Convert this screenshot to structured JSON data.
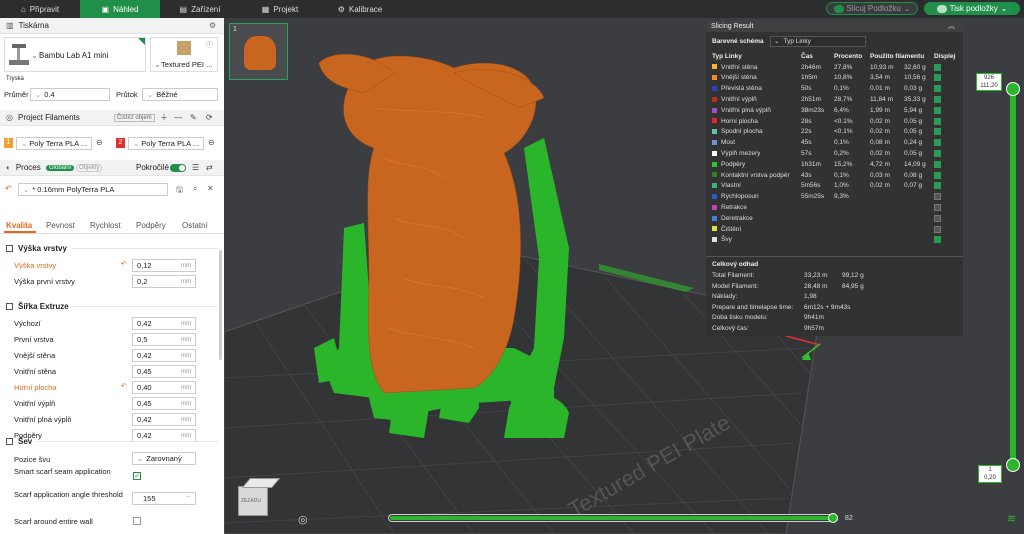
{
  "topbar": {
    "tabs": [
      {
        "label": "Připravit",
        "icon": "home-icon"
      },
      {
        "label": "Náhled",
        "icon": "preview-icon"
      },
      {
        "label": "Zařízení",
        "icon": "device-icon"
      },
      {
        "label": "Projekt",
        "icon": "project-icon"
      },
      {
        "label": "Kalibrace",
        "icon": "calibration-icon"
      }
    ],
    "active_tab": "Náhled",
    "slice_button": "Slicuj Podložku",
    "print_button": "Tisk podložky"
  },
  "printer": {
    "section_title": "Tiskárna",
    "printer_name": "Bambu Lab A1 mini",
    "plate_name": "Textured PEI ...",
    "nozzle_label": "Tryska",
    "diameter_label": "Průměr",
    "diameter_value": "0.4",
    "flow_label": "Průtok",
    "flow_value": "Běžné"
  },
  "filaments": {
    "section_title": "Project Filaments",
    "clean_button": "Čistící objem",
    "items": [
      {
        "index": "1",
        "name": "Poly Terra PLA ...",
        "color": "#f0a030"
      },
      {
        "index": "2",
        "name": "Poly Terra PLA ...",
        "color": "#e03030"
      }
    ]
  },
  "process": {
    "section_title": "Proces",
    "toggle_global": "Globální",
    "toggle_objects": "Objekty",
    "advanced_label": "Pokročilé",
    "preset_name": "* 0.16mm PolyTerra PLA",
    "tabs": [
      "Kvalita",
      "Pevnost",
      "Rychlost",
      "Podpěry",
      "Ostatní"
    ],
    "active_tab": "Kvalita",
    "groups": [
      {
        "title": "Výška vrstvy",
        "rows": [
          {
            "label": "Výška vrstvy",
            "value": "0,12",
            "unit": "mm",
            "modified": true
          },
          {
            "label": "Výška první vrstvy",
            "value": "0,2",
            "unit": "mm",
            "modified": false
          }
        ]
      },
      {
        "title": "Šířka Extruze",
        "rows": [
          {
            "label": "Výchozí",
            "value": "0,42",
            "unit": "mm",
            "modified": false
          },
          {
            "label": "První vrstva",
            "value": "0,5",
            "unit": "mm",
            "modified": false
          },
          {
            "label": "Vnější stěna",
            "value": "0,42",
            "unit": "mm",
            "modified": false
          },
          {
            "label": "Vnitřní stěna",
            "value": "0,45",
            "unit": "mm",
            "modified": false
          },
          {
            "label": "Horní plocha",
            "value": "0,40",
            "unit": "mm",
            "modified": true
          },
          {
            "label": "Vnitřní výplň",
            "value": "0,45",
            "unit": "mm",
            "modified": false
          },
          {
            "label": "Vnitřní plná výplň",
            "value": "0,42",
            "unit": "mm",
            "modified": false
          },
          {
            "label": "Podpěry",
            "value": "0,42",
            "unit": "mm",
            "modified": false
          }
        ]
      },
      {
        "title": "Šev",
        "rows": [
          {
            "label": "Pozice švu",
            "value": "Zarovnaný"
          },
          {
            "label": "Smart scarf seam application",
            "checked": true
          },
          {
            "label": "Scarf application angle threshold",
            "value": "155"
          },
          {
            "label": "Scarf around entire wall",
            "checked": false
          }
        ]
      }
    ]
  },
  "slicing_result": {
    "title": "Slicing Result",
    "scheme_label": "Barevné schéma",
    "scheme_value": "Typ Linky",
    "headers": [
      "Typ Linky",
      "Čas",
      "Procento",
      "Použito filamentu",
      "Displej"
    ],
    "rows": [
      {
        "name": "Vnitřní stěna",
        "color": "#f5b53a",
        "time": "2h46m",
        "pct": "27,8%",
        "len": "10,93 m",
        "weight": "32,60 g",
        "on": true
      },
      {
        "name": "Vnější stěna",
        "color": "#f08a2a",
        "time": "1h5m",
        "pct": "10,8%",
        "len": "3,54 m",
        "weight": "10,56 g",
        "on": true
      },
      {
        "name": "Převislá stěna",
        "color": "#2640c8",
        "time": "50s",
        "pct": "0,1%",
        "len": "0,01 m",
        "weight": "0,03 g",
        "on": true
      },
      {
        "name": "Vnitřní výplň",
        "color": "#b8301a",
        "time": "2h51m",
        "pct": "28,7%",
        "len": "11,84 m",
        "weight": "35,33 g",
        "on": true
      },
      {
        "name": "Vnitřní plná výplň",
        "color": "#a050c8",
        "time": "38m23s",
        "pct": "6,4%",
        "len": "1,99 m",
        "weight": "5,94 g",
        "on": true
      },
      {
        "name": "Horní plocha",
        "color": "#e02828",
        "time": "28s",
        "pct": "<0.1%",
        "len": "0,02 m",
        "weight": "0,05 g",
        "on": true
      },
      {
        "name": "Spodní plocha",
        "color": "#60c0b0",
        "time": "22s",
        "pct": "<0.1%",
        "len": "0,02 m",
        "weight": "0,05 g",
        "on": true
      },
      {
        "name": "Most",
        "color": "#7090d0",
        "time": "45s",
        "pct": "0,1%",
        "len": "0,08 m",
        "weight": "0,24 g",
        "on": true
      },
      {
        "name": "Výplň mezery",
        "color": "#ffffff",
        "time": "57s",
        "pct": "0,2%",
        "len": "0,02 m",
        "weight": "0,05 g",
        "on": true
      },
      {
        "name": "Podpěry",
        "color": "#30c030",
        "time": "1h31m",
        "pct": "15,2%",
        "len": "4,72 m",
        "weight": "14,09 g",
        "on": true
      },
      {
        "name": "Kontaktní vrstva podpěr",
        "color": "#308030",
        "time": "43s",
        "pct": "0,1%",
        "len": "0,03 m",
        "weight": "0,08 g",
        "on": true
      },
      {
        "name": "Vlastní",
        "color": "#40b080",
        "time": "5m56s",
        "pct": "1,0%",
        "len": "0,02 m",
        "weight": "0,07 g",
        "on": true
      },
      {
        "name": "Rychloposun",
        "color": "#2060c0",
        "time": "55m25s",
        "pct": "9,3%",
        "len": "",
        "weight": "",
        "on": false
      },
      {
        "name": "Retrakce",
        "color": "#c040c0",
        "time": "",
        "pct": "",
        "len": "",
        "weight": "",
        "on": false
      },
      {
        "name": "Deretrakce",
        "color": "#4080e0",
        "time": "",
        "pct": "",
        "len": "",
        "weight": "",
        "on": false
      },
      {
        "name": "Čištění",
        "color": "#e0e040",
        "time": "",
        "pct": "",
        "len": "",
        "weight": "",
        "on": false
      },
      {
        "name": "Švy",
        "color": "#e0e0e0",
        "time": "",
        "pct": "",
        "len": "",
        "weight": "",
        "on": true
      }
    ],
    "estimate_title": "Celkový odhad",
    "estimates": [
      {
        "label": "Total Filament:",
        "v1": "33,23 m",
        "v2": "99,12 g"
      },
      {
        "label": "Model Filament:",
        "v1": "28,48 m",
        "v2": "84,95 g"
      },
      {
        "label": "Náklady:",
        "v1": "1,98",
        "v2": ""
      },
      {
        "label": "Prepare and timelapse time:",
        "v1": "6m12s + 9m43s",
        "v2": ""
      },
      {
        "label": "Doba tisku modelu:",
        "v1": "9h41m",
        "v2": ""
      },
      {
        "label": "Celkový čas:",
        "v1": "9h57m",
        "v2": ""
      }
    ]
  },
  "viewport": {
    "plate_thumb_index": "1",
    "plate_text": "Textured PEI Plate",
    "layer_top": "926",
    "layer_top_height": "111,20",
    "layer_bottom": "1",
    "layer_bottom_height": "0,20",
    "move_value": "82",
    "cube_label": "ZEZADU"
  }
}
